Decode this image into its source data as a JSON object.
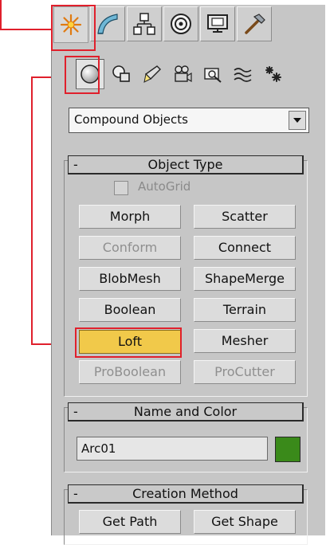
{
  "dropdown": {
    "value": "Compound Objects"
  },
  "object_type": {
    "title": "Object Type",
    "collapse_symbol": "-",
    "autogrid_label": "AutoGrid",
    "buttons": [
      {
        "label": "Morph"
      },
      {
        "label": "Scatter"
      },
      {
        "label": "Conform"
      },
      {
        "label": "Connect"
      },
      {
        "label": "BlobMesh"
      },
      {
        "label": "ShapeMerge"
      },
      {
        "label": "Boolean"
      },
      {
        "label": "Terrain"
      },
      {
        "label": "Loft"
      },
      {
        "label": "Mesher"
      },
      {
        "label": "ProBoolean"
      },
      {
        "label": "ProCutter"
      }
    ]
  },
  "name_color": {
    "title": "Name and Color",
    "collapse_symbol": "-",
    "name_value": "Arc01",
    "swatch_color": "#3a8a1a"
  },
  "creation_method": {
    "title": "Creation Method",
    "collapse_symbol": "-",
    "get_path": "Get Path",
    "get_shape": "Get Shape"
  },
  "colors": {
    "highlight": "#e0202c",
    "pressed": "#f1c94a"
  },
  "icons": {
    "main_tabs": [
      "create-icon",
      "modify-icon",
      "hierarchy-icon",
      "motion-icon",
      "display-icon",
      "utilities-icon"
    ],
    "sub_categories": [
      "geometry-icon",
      "shapes-icon",
      "lights-icon",
      "cameras-icon",
      "helpers-icon",
      "space-warps-icon",
      "systems-icon"
    ]
  }
}
